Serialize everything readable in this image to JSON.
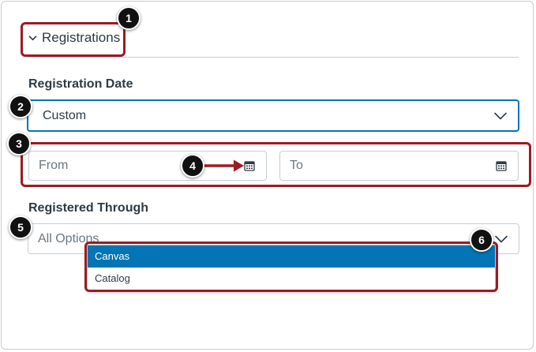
{
  "registrations_section": {
    "title": "Registrations",
    "expanded": true
  },
  "registration_date": {
    "label": "Registration Date",
    "selected": "Custom",
    "from_placeholder": "From",
    "to_placeholder": "To"
  },
  "registered_through": {
    "label": "Registered Through",
    "placeholder": "All Options",
    "options": [
      {
        "label": "Canvas",
        "highlighted": true
      },
      {
        "label": "Catalog",
        "highlighted": false
      }
    ]
  },
  "callouts": [
    "1",
    "2",
    "3",
    "4",
    "5",
    "6"
  ],
  "colors": {
    "accent": "#0374b5",
    "callout": "#9b1b24",
    "text": "#2d3b45",
    "border": "#c7cdd1"
  },
  "icons": [
    "chevron-down-icon",
    "calendar-icon",
    "arrow-right-icon"
  ]
}
